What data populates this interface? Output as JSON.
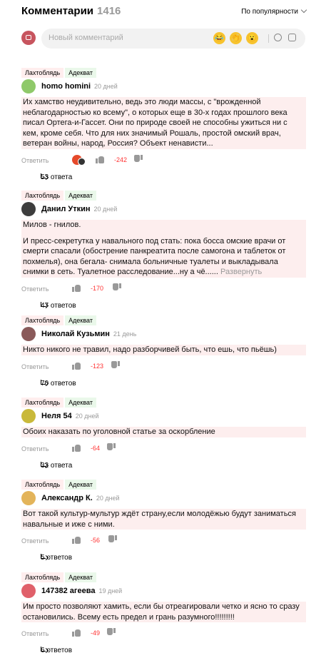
{
  "header": {
    "title": "Комментарии",
    "count": "1416",
    "sort_label": "По популярности"
  },
  "composer": {
    "placeholder": "Новый комментарий",
    "emojis": [
      "😂",
      "👏",
      "😮"
    ]
  },
  "labels": {
    "reply": "Ответить",
    "expand": "Развернуть"
  },
  "comments": [
    {
      "badges": [
        "Лахтоблядь",
        "Адекват"
      ],
      "author": "homo homini",
      "date": "20 дней",
      "avatar_color": "#8fc96a",
      "paragraphs": [
        "Их хамство неудивительно, ведь это люди массы, с \"врожденной неблагодарностью ко всему\", о которых еще в 30-х годах прошлого века писал Ортега-и-Гассет. Они по природе своей не способны ужиться ни с кем, кроме себя. Что для них значимый Рошаль, простой омский врач, ветеран войны, народ, Россия? Объект ненависти..."
      ],
      "score": "-242",
      "replies": "53 ответа"
    },
    {
      "badges": [
        "Лахтоблядь",
        "Адекват"
      ],
      "author": "Данил Уткин",
      "date": "20 дней",
      "avatar_color": "#3d3d3d",
      "paragraphs": [
        "Милов - гнилов.",
        "И пресс-секретутка у навального под стать: пока босса омские врачи от смерти спасали (обострение панкреатита после самогона и таблеток от похмелья), она бегала- снимала больничные туалеты и выкладывала снимки в сеть. Туалетное расследование...ну а чё...... "
      ],
      "score": "-170",
      "replies": "47 ответов"
    },
    {
      "badges": [
        "Лахтоблядь",
        "Адекват"
      ],
      "author": "Николай Кузьмин",
      "date": "21 день",
      "avatar_color": "#8a5a5a",
      "paragraphs": [
        "Никто никого не травил, надо разборчивей быть, что ешь, что пьёшь)"
      ],
      "score": "-123",
      "replies": "70 ответов"
    },
    {
      "badges": [
        "Лахтоблядь",
        "Адекват"
      ],
      "author": "Неля 54",
      "date": "20 дней",
      "avatar_color": "#c9b93a",
      "paragraphs": [
        "Обоих наказать по уголовной статье за оскорбление"
      ],
      "score": "-64",
      "replies": "32 ответа"
    },
    {
      "badges": [
        "Лахтоблядь",
        "Адекват"
      ],
      "author": "Александр К.",
      "date": "20 дней",
      "avatar_color": "#e3b45a",
      "paragraphs": [
        "Вот такой культур-мультур ждёт страну,если молодёжью будут заниматься навальные и иже с ними."
      ],
      "score": "-56",
      "replies": "5 ответов"
    },
    {
      "badges": [
        "Лахтоблядь",
        "Адекват"
      ],
      "author": "147382 агеева",
      "date": "19 дней",
      "avatar_color": "#e0606a",
      "paragraphs": [
        "Им просто позволяют хамить, если бы отреагировали четко и ясно то сразу остановились. Всему есть предел и грань разумного!!!!!!!!!"
      ],
      "score": "-49",
      "replies": "6 ответов"
    }
  ]
}
